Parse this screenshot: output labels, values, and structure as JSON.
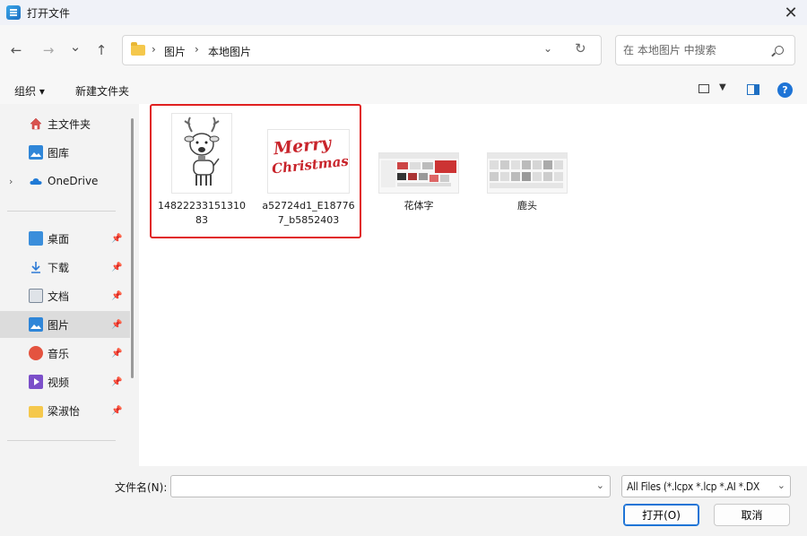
{
  "window": {
    "title": "打开文件",
    "close_glyph": "✕"
  },
  "nav": {
    "back_glyph": "←",
    "forward_glyph": "→",
    "recent_glyph": "⌄",
    "up_glyph": "↑",
    "breadcrumb": [
      "图片",
      "本地图片"
    ],
    "crumb_sep": "›",
    "address_dropdown_glyph": "⌄",
    "refresh_glyph": "↻",
    "search_placeholder": "在 本地图片 中搜索"
  },
  "toolbar": {
    "organize": "组织 ▾",
    "new_folder": "新建文件夹",
    "view_dropdown_glyph": "▼",
    "help": "?"
  },
  "sidebar": {
    "top_items": [
      {
        "label": "主文件夹",
        "icon": "home-icon"
      },
      {
        "label": "图库",
        "icon": "gallery-icon"
      },
      {
        "label": "OneDrive",
        "icon": "cloud-icon",
        "expander": "›"
      }
    ],
    "pinned_items": [
      {
        "label": "桌面",
        "icon": "desktop-icon",
        "color": "#3a8edb"
      },
      {
        "label": "下载",
        "icon": "download-icon",
        "color": "#2e7bd6"
      },
      {
        "label": "文档",
        "icon": "document-icon",
        "color": "#7a8899"
      },
      {
        "label": "图片",
        "icon": "pictures-icon",
        "color": "#2f86d8",
        "selected": true
      },
      {
        "label": "音乐",
        "icon": "music-icon",
        "color": "#e4533f"
      },
      {
        "label": "视频",
        "icon": "video-icon",
        "color": "#7b4fc9"
      },
      {
        "label": "梁淑怡",
        "icon": "folder-icon",
        "color": "#f5c84c"
      }
    ],
    "pin_glyph": "📌"
  },
  "files": [
    {
      "name": "1482223315131083",
      "thumb": "reindeer-image"
    },
    {
      "name": "a52724d1_E187767_b5852403",
      "thumb": "merry-christmas-image"
    },
    {
      "name": "花体字",
      "thumb": "folder-thumbnail"
    },
    {
      "name": "鹿头",
      "thumb": "folder-thumbnail"
    }
  ],
  "merry_text": [
    "Merry",
    "Christmas"
  ],
  "bottom": {
    "filename_label": "文件名(N):",
    "filename_value": "",
    "filename_dropdown_glyph": "⌄",
    "filter": "All Files (*.lcpx *.lcp *.AI *.DX",
    "filter_dropdown_glyph": "⌄",
    "open_button": "打开(O)",
    "cancel_button": "取消"
  },
  "colors": {
    "accent": "#1e74d6",
    "highlight": "#e02020",
    "merry": "#c8242b"
  }
}
